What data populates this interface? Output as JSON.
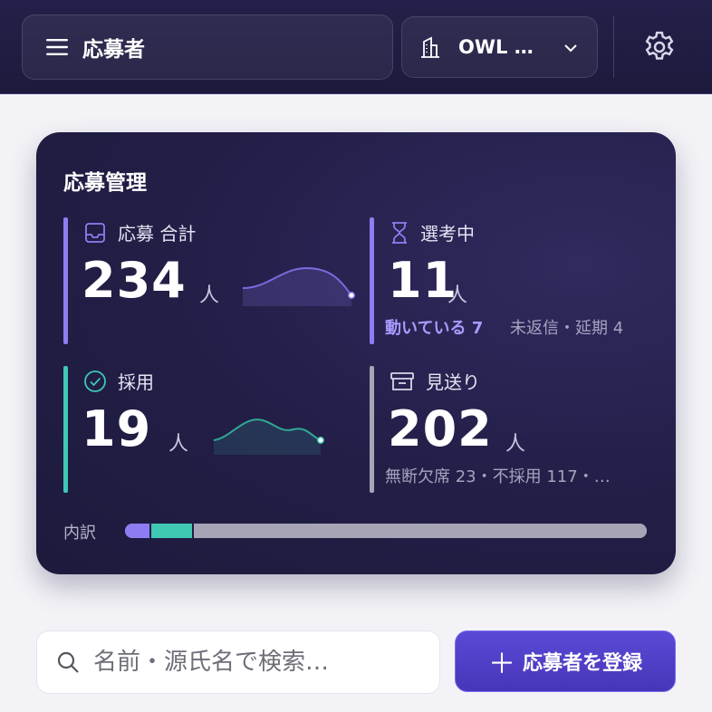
{
  "header": {
    "title": "応募者",
    "org_name": "OWL …",
    "icons": {
      "menu": "hamburger-icon",
      "org": "building-icon",
      "chevron": "chevron-down-icon",
      "settings": "gear-icon"
    }
  },
  "card": {
    "title": "応募管理",
    "stats": {
      "total": {
        "label": "応募 合計",
        "value": "234",
        "unit": "人",
        "icon": "inbox-icon",
        "color": "#8e7df2"
      },
      "screening": {
        "label": "選考中",
        "value": "11",
        "unit": "人",
        "icon": "hourglass-icon",
        "color": "#8e7df2",
        "sub_highlight": "動いている 7",
        "sub_rest": "未返信・延期 4"
      },
      "hired": {
        "label": "採用",
        "value": "19",
        "unit": "人",
        "icon": "check-circle-icon",
        "color": "#3fc8b4"
      },
      "declined": {
        "label": "見送り",
        "value": "202",
        "unit": "人",
        "icon": "archive-box-icon",
        "color": "#a7a4b6",
        "sub": "無断欠席 23・不採用 117・…"
      }
    },
    "breakdown": {
      "label": "内訳",
      "segments": [
        {
          "name": "選考中",
          "value": 11,
          "color": "#8e7df2"
        },
        {
          "name": "採用",
          "value": 19,
          "color": "#3fc8b4"
        },
        {
          "name": "見送り",
          "value": 202,
          "color": "#a7a4b6"
        }
      ]
    }
  },
  "search": {
    "placeholder": "名前・源氏名で検索…"
  },
  "add_button": {
    "label": "応募者を登録",
    "icon": "plus-icon"
  }
}
